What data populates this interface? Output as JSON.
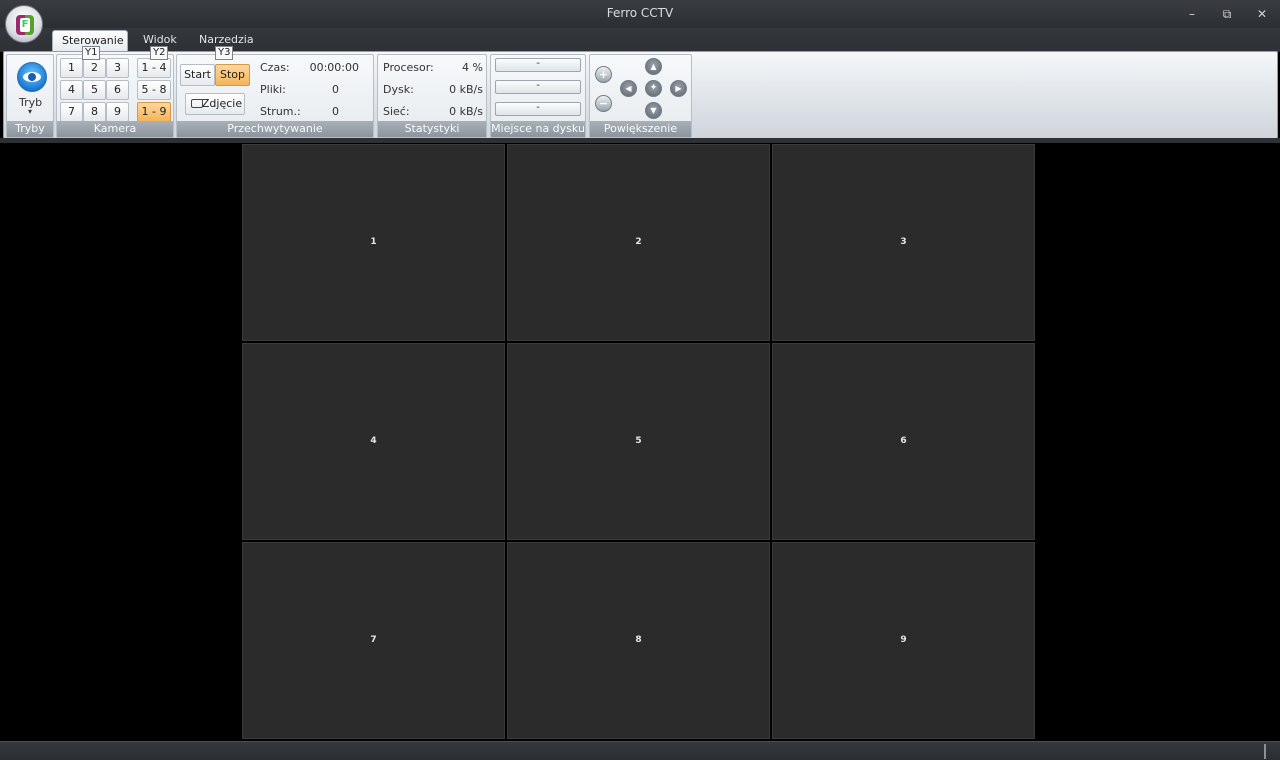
{
  "window": {
    "title": "Ferro CCTV",
    "minimize": "–",
    "restore": "⧉",
    "close": "✕",
    "app_logo_letter": "F"
  },
  "tabs": [
    {
      "label": "Sterowanie",
      "active": true,
      "keytip": "Y1"
    },
    {
      "label": "Widok",
      "active": false,
      "keytip": "Y2"
    },
    {
      "label": "Narzedzia",
      "active": false,
      "keytip": "Y3"
    }
  ],
  "ribbon": {
    "tryby": {
      "button_label": "Tryb",
      "dropdown_arrow": "▾",
      "group_label": "Tryby"
    },
    "kamera": {
      "numbers": [
        "1",
        "2",
        "3",
        "4",
        "5",
        "6",
        "7",
        "8",
        "9"
      ],
      "ranges": [
        "1 - 4",
        "5 - 8",
        "1 - 9"
      ],
      "selected_range": "1 - 9",
      "group_label": "Kamera"
    },
    "przechwytywanie": {
      "start": "Start",
      "stop": "Stop",
      "snapshot": "Zdjęcie",
      "rows": [
        {
          "label": "Czas:",
          "value": "00:00:00"
        },
        {
          "label": "Pliki:",
          "value": "0"
        },
        {
          "label": "Strum.:",
          "value": "0"
        }
      ],
      "group_label": "Przechwytywanie"
    },
    "statystyki": {
      "rows": [
        {
          "label": "Procesor:",
          "value": "4 %"
        },
        {
          "label": "Dysk:",
          "value": "0 kB/s"
        },
        {
          "label": "Sieć:",
          "value": "0 kB/s"
        }
      ],
      "group_label": "Statystyki"
    },
    "miejsce": {
      "bars": [
        "-",
        "-",
        "-"
      ],
      "group_label": "Miejsce na dysku"
    },
    "powiekszenie": {
      "zoom_in": "+",
      "zoom_out": "−",
      "up": "▲",
      "down": "▼",
      "left": "◀",
      "right": "▶",
      "center": "✦",
      "group_label": "Powiększenie"
    }
  },
  "cameras": [
    "1",
    "2",
    "3",
    "4",
    "5",
    "6",
    "7",
    "8",
    "9"
  ],
  "colors": {
    "accent": "#f4b45a",
    "cell_bg": "#2b2b2b",
    "background": "#000000"
  }
}
